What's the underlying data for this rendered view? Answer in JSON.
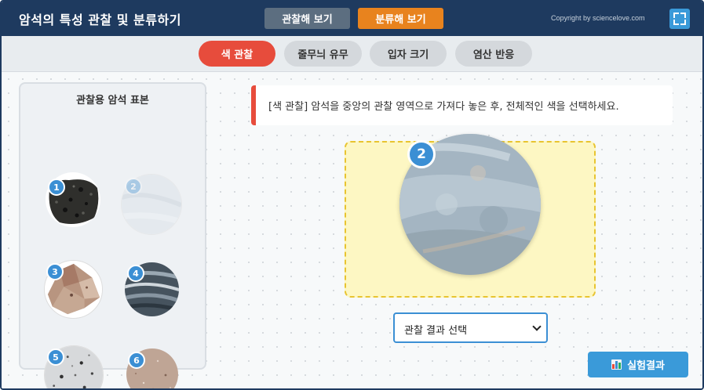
{
  "header": {
    "title": "암석의 특성 관찰 및 분류하기",
    "view_button": "관찰해 보기",
    "classify_button": "분류해 보기",
    "copyright": "Copyright by sciencelove.com",
    "fullscreen_icon": "fullscreen-icon"
  },
  "tabs": [
    {
      "label": "색 관찰",
      "active": true
    },
    {
      "label": "줄무늬 유무",
      "active": false
    },
    {
      "label": "입자 크기",
      "active": false
    },
    {
      "label": "염산 반응",
      "active": false
    }
  ],
  "sample_panel": {
    "title": "관찰용 암석 표본",
    "samples": [
      {
        "number": "1",
        "state": "available"
      },
      {
        "number": "2",
        "state": "in-use"
      },
      {
        "number": "3",
        "state": "available"
      },
      {
        "number": "4",
        "state": "available"
      },
      {
        "number": "5",
        "state": "available"
      },
      {
        "number": "6",
        "state": "available"
      }
    ]
  },
  "instruction": {
    "text": "[색 관찰] 암석을 중앙의 관찰 영역으로 가져다 놓은 후, 전체적인 색을 선택하세요."
  },
  "observation": {
    "placed_sample_number": "2"
  },
  "result_select": {
    "selected": "관찰 결과 선택"
  },
  "results_button": {
    "label": "실험결과",
    "icon": "bar-chart-icon"
  },
  "colors": {
    "header_bg": "#1e3a5f",
    "accent_red": "#e74c3c",
    "accent_orange": "#e8831e",
    "accent_blue": "#3b8fd4",
    "drop_zone": "#fdf7c3"
  }
}
